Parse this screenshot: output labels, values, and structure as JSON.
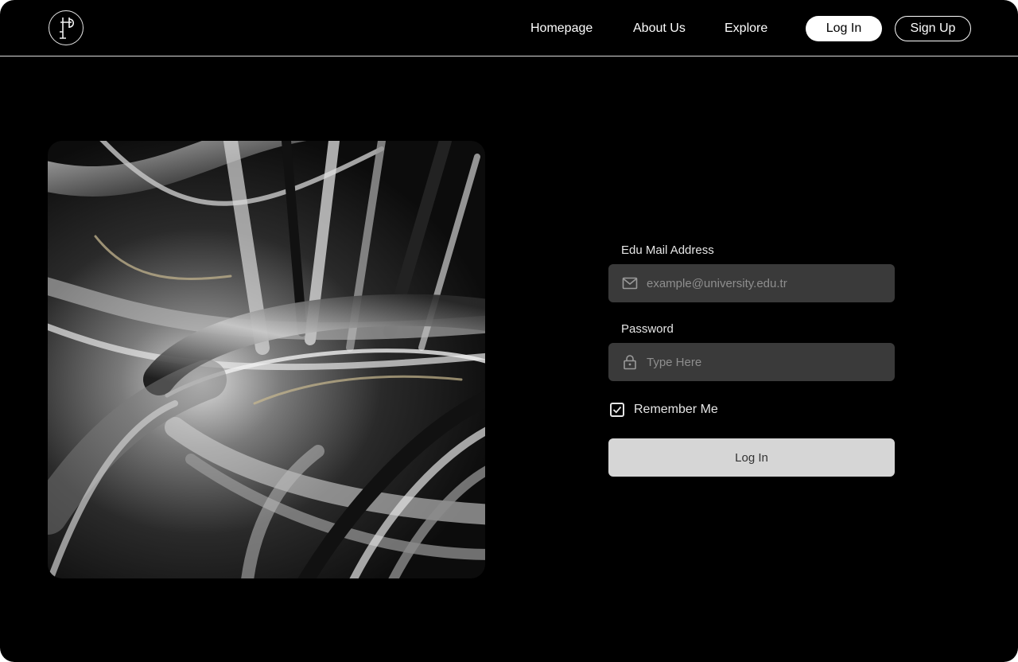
{
  "nav": {
    "links": [
      "Homepage",
      "About Us",
      "Explore"
    ],
    "login_label": "Log In",
    "signup_label": "Sign Up"
  },
  "logo": {
    "icon": "pi-monogram-icon"
  },
  "hero": {
    "image": "abstract-glass-swirl-image"
  },
  "form": {
    "email_label": "Edu Mail Address",
    "email_placeholder": "example@university.edu.tr",
    "email_icon": "mail-icon",
    "password_label": "Password",
    "password_placeholder": "Type Here",
    "password_icon": "lock-icon",
    "remember_label": "Remember Me",
    "remember_checked": true,
    "submit_label": "Log In"
  },
  "colors": {
    "background": "#000000",
    "field_bg": "#3a3a3a",
    "submit_bg": "#d6d6d6",
    "header_divider": "#d9d9d9"
  }
}
